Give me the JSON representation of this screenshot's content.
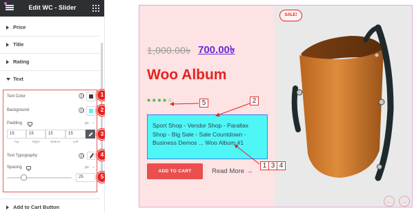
{
  "panel": {
    "title": "Edit WC - Slider",
    "sections": {
      "price": "Price",
      "title": "Title",
      "rating": "Rating",
      "text": "Text",
      "add_to_cart": "Add to Cart Button"
    },
    "controls": {
      "text_color_label": "Text Color",
      "text_color_value": "#3c3c3c",
      "background_label": "Background",
      "background_value": "#4ff6f6",
      "padding_label": "Padding",
      "padding_unit": "px",
      "padding_values": [
        "15",
        "15",
        "15",
        "15"
      ],
      "padding_sides": [
        "Top",
        "Right",
        "Bottom",
        "Left"
      ],
      "typography_label": "Text Typography",
      "spacing_label": "Spacing",
      "spacing_unit": "px",
      "spacing_value": "25",
      "spacing_level": 0.25
    }
  },
  "badges": [
    "1",
    "2",
    "3",
    "4",
    "5"
  ],
  "slide": {
    "old_price": "1,000.00৳",
    "new_price": "700.00৳",
    "product_title": "Woo Album",
    "rating_stars": "★★★★☆",
    "rating": 4,
    "description": "Sport Shop - Vendor Shop - Parallax Shop - Big Sale - Sale Countdown - Business Demos ... Woo Album #1",
    "cart_button": "ADD TO CART",
    "read_more": "Read More",
    "read_more_arrow": "→",
    "sale_badge": "SALE!",
    "nav_prev": "←",
    "nav_next": "→"
  },
  "annotations": {
    "box_5": "5",
    "box_2": "2",
    "box_1": "1",
    "box_3": "3",
    "box_4": "4"
  },
  "colors": {
    "accent_red": "#e62222",
    "slide_bg": "#fde3e3",
    "price_purple": "#6b2bd9",
    "description_bg": "#4ff6f6",
    "button_red": "#ea4e4e"
  }
}
